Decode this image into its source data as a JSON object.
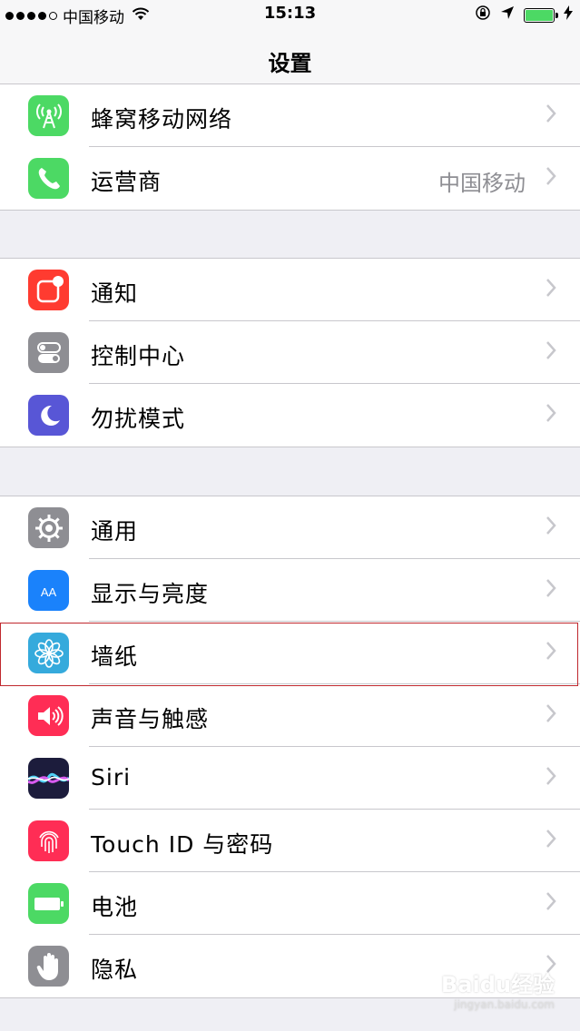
{
  "status_bar": {
    "carrier": "中国移动",
    "time": "15:13"
  },
  "nav": {
    "title": "设置"
  },
  "groups": [
    {
      "rows": [
        {
          "label": "蜂窝移动网络",
          "icon": "cellular-antenna-icon",
          "icon_color": "#4cd964"
        },
        {
          "label": "运营商",
          "value": "中国移动",
          "icon": "phone-icon",
          "icon_color": "#4cd964"
        }
      ]
    },
    {
      "rows": [
        {
          "label": "通知",
          "icon": "notifications-icon",
          "icon_color": "#ff3b30"
        },
        {
          "label": "控制中心",
          "icon": "control-center-icon",
          "icon_color": "#8e8e93"
        },
        {
          "label": "勿扰模式",
          "icon": "moon-icon",
          "icon_color": "#5856d6"
        }
      ]
    },
    {
      "rows": [
        {
          "label": "通用",
          "icon": "gear-icon",
          "icon_color": "#8e8e93"
        },
        {
          "label": "显示与亮度",
          "icon": "text-size-icon",
          "icon_text": "AA",
          "icon_color": "#1a82fb"
        },
        {
          "label": "墙纸",
          "icon": "wallpaper-flower-icon",
          "icon_color": "#35aadc"
        },
        {
          "label": "声音与触感",
          "icon": "speaker-icon",
          "icon_color": "#ff2d55"
        },
        {
          "label": "Siri",
          "icon": "siri-icon",
          "icon_color": "#1c1c3c"
        },
        {
          "label": "Touch ID 与密码",
          "icon": "fingerprint-icon",
          "icon_color": "#ff2d55"
        },
        {
          "label": "电池",
          "icon": "battery-icon",
          "icon_color": "#4cd964"
        },
        {
          "label": "隐私",
          "icon": "hand-icon",
          "icon_color": "#8e8e93"
        }
      ]
    }
  ],
  "highlighted_row": "墙纸",
  "watermark": {
    "brand": "Baidu经验",
    "url": "jingyan.baidu.com"
  },
  "colors": {
    "accent_green": "#4cd964",
    "highlight_border": "#c0282e",
    "background": "#efeff4"
  }
}
